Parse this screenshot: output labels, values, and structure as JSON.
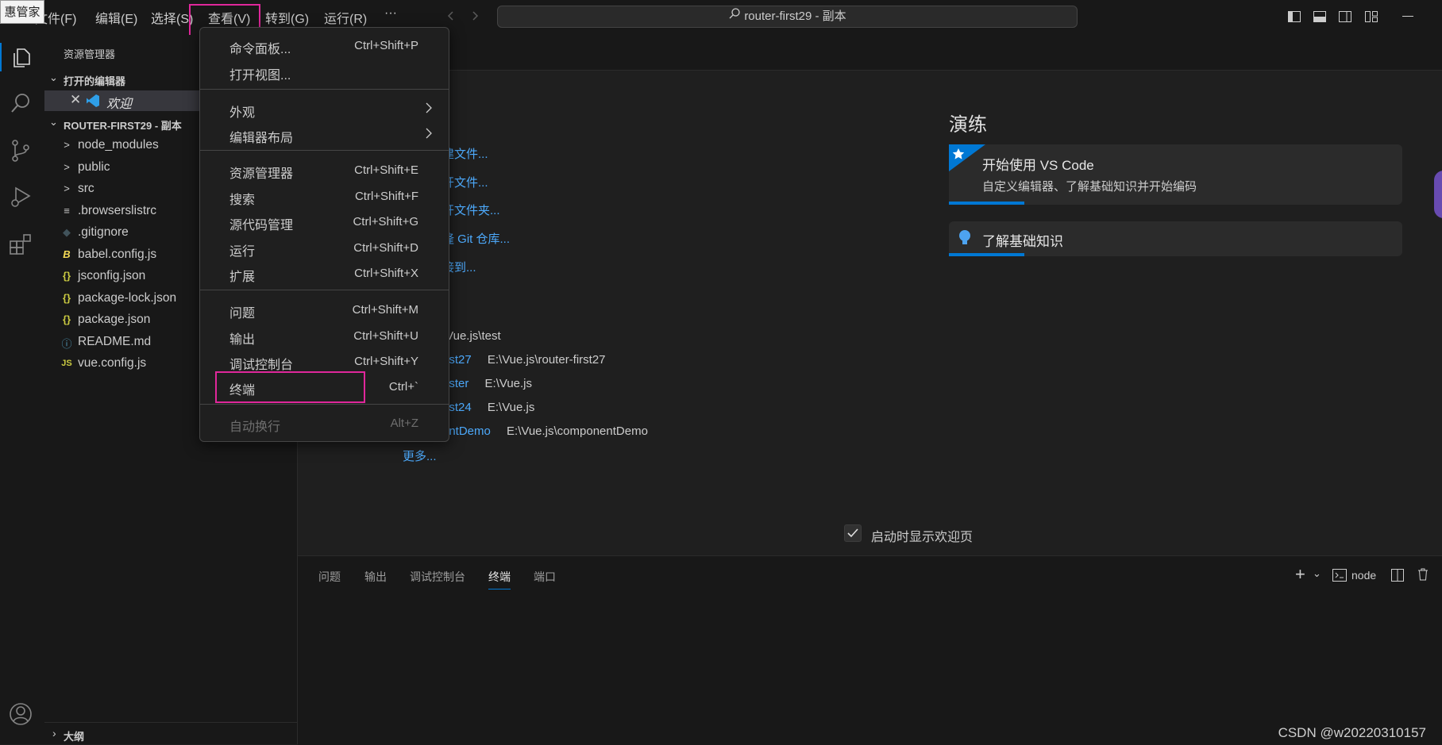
{
  "titlebar": {
    "tooltip_fragment": "惠管家",
    "menus": [
      "文件(F)",
      "编辑(E)",
      "选择(S)",
      "查看(V)",
      "转到(G)",
      "运行(R)",
      "···"
    ],
    "search_text": "router-first29 - 副本"
  },
  "sidebar": {
    "header": "资源管理器",
    "open_editors_title": "打开的编辑器",
    "open_editor_item": "欢迎",
    "project_title": "ROUTER-FIRST29 - 副本",
    "files": [
      {
        "icon": ">",
        "name": "node_modules"
      },
      {
        "icon": ">",
        "name": "public"
      },
      {
        "icon": ">",
        "name": "src"
      },
      {
        "icon": "≡",
        "name": ".browserslistrc"
      },
      {
        "icon": "◆",
        "name": ".gitignore"
      },
      {
        "icon": "B",
        "name": "babel.config.js"
      },
      {
        "icon": "{}",
        "name": "jsconfig.json"
      },
      {
        "icon": "{}",
        "name": "package-lock.json"
      },
      {
        "icon": "{}",
        "name": "package.json"
      },
      {
        "icon": "ⓘ",
        "name": "README.md"
      },
      {
        "icon": "JS",
        "name": "vue.config.js"
      }
    ],
    "outline_title": "大纲"
  },
  "welcome": {
    "start_links": [
      "建文件...",
      "开文件...",
      "开文件夹...",
      "隆 Git 仓库...",
      "接到..."
    ],
    "recent": [
      {
        "name": "",
        "path": "\\Vue.js\\test"
      },
      {
        "name": "irst27",
        "path": "E:\\Vue.js\\router-first27"
      },
      {
        "name": "aster",
        "path": "E:\\Vue.js"
      },
      {
        "name": "irst24",
        "path": "E:\\Vue.js"
      },
      {
        "name": "entDemo",
        "path": "E:\\Vue.js\\componentDemo"
      }
    ],
    "more": "更多...",
    "walkthrough_title": "演练",
    "card1_title": "开始使用 VS Code",
    "card1_desc": "自定义编辑器、了解基础知识并开始编码",
    "card2_title": "了解基础知识",
    "show_on_startup": "启动时显示欢迎页"
  },
  "panel": {
    "tabs": [
      "问题",
      "输出",
      "调试控制台",
      "终端",
      "端口"
    ],
    "active_tab": "终端",
    "terminal_name": "node"
  },
  "view_menu": {
    "items": [
      {
        "label": "命令面板...",
        "key": "Ctrl+Shift+P"
      },
      {
        "label": "打开视图...",
        "key": ""
      },
      {
        "label": "外观",
        "key": "",
        "submenu": true
      },
      {
        "label": "编辑器布局",
        "key": "",
        "submenu": true
      },
      {
        "label": "资源管理器",
        "key": "Ctrl+Shift+E"
      },
      {
        "label": "搜索",
        "key": "Ctrl+Shift+F"
      },
      {
        "label": "源代码管理",
        "key": "Ctrl+Shift+G"
      },
      {
        "label": "运行",
        "key": "Ctrl+Shift+D"
      },
      {
        "label": "扩展",
        "key": "Ctrl+Shift+X"
      },
      {
        "label": "问题",
        "key": "Ctrl+Shift+M"
      },
      {
        "label": "输出",
        "key": "Ctrl+Shift+U"
      },
      {
        "label": "调试控制台",
        "key": "Ctrl+Shift+Y"
      },
      {
        "label": "终端",
        "key": "Ctrl+`"
      },
      {
        "label": "自动换行",
        "key": "Alt+Z",
        "disabled": true
      }
    ]
  },
  "watermark": "CSDN @w20220310157",
  "colors": {
    "accent": "#0078d4",
    "highlight_box": "#e0279b",
    "link": "#4daafc"
  }
}
